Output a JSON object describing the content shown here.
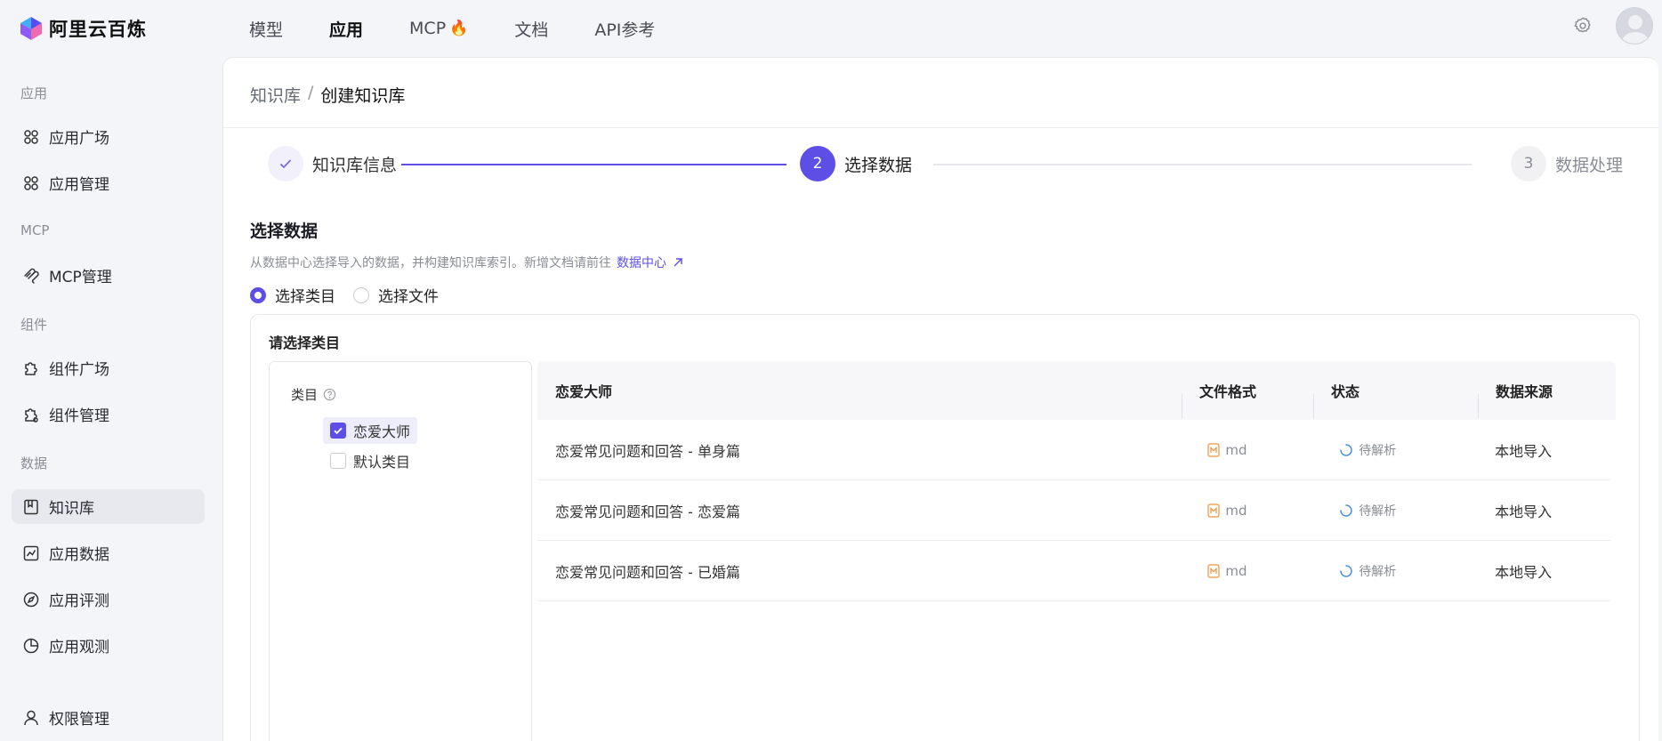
{
  "brand": {
    "name": "阿里云百炼"
  },
  "topnav": [
    {
      "label": "模型",
      "active": false
    },
    {
      "label": "应用",
      "active": true
    },
    {
      "label": "MCP",
      "active": false
    },
    {
      "label": "文档",
      "active": false
    },
    {
      "label": "API参考",
      "active": false
    }
  ],
  "sidebar": {
    "groups": {
      "app": "应用",
      "mcp": "MCP",
      "component": "组件",
      "data": "数据"
    },
    "items": {
      "app_plaza": "应用广场",
      "app_manage": "应用管理",
      "mcp_manage": "MCP管理",
      "comp_plaza": "组件广场",
      "comp_manage": "组件管理",
      "knowledge": "知识库",
      "app_data": "应用数据",
      "app_eval": "应用评测",
      "app_observe": "应用观测",
      "permission": "权限管理"
    }
  },
  "breadcrumb": {
    "parent": "知识库",
    "separator": "/",
    "current": "创建知识库"
  },
  "steps": [
    {
      "index": "1",
      "label": "知识库信息",
      "state": "done"
    },
    {
      "index": "2",
      "label": "选择数据",
      "state": "active"
    },
    {
      "index": "3",
      "label": "数据处理",
      "state": "todo"
    }
  ],
  "section": {
    "title": "选择数据",
    "description": "从数据中心选择导入的数据，并构建知识库索引。新增文档请前往",
    "link": "数据中心"
  },
  "radio": {
    "option1": "选择类目",
    "option2": "选择文件",
    "selected": "option1"
  },
  "panel": {
    "title": "请选择类目",
    "tree_header": "类目",
    "categories": [
      {
        "label": "恋爱大师",
        "checked": true
      },
      {
        "label": "默认类目",
        "checked": false
      }
    ]
  },
  "table": {
    "headers": {
      "name": "恋爱大师",
      "format": "文件格式",
      "status": "状态",
      "source": "数据来源"
    },
    "rows": [
      {
        "name": "恋爱常见问题和回答 - 单身篇",
        "format": "md",
        "status": "待解析",
        "source": "本地导入"
      },
      {
        "name": "恋爱常见问题和回答 - 恋爱篇",
        "format": "md",
        "status": "待解析",
        "source": "本地导入"
      },
      {
        "name": "恋爱常见问题和回答 - 已婚篇",
        "format": "md",
        "status": "待解析",
        "source": "本地导入"
      }
    ]
  },
  "colors": {
    "accent": "#5d4fe6",
    "md_icon": "#f0913a",
    "status_icon": "#4a90e2"
  }
}
